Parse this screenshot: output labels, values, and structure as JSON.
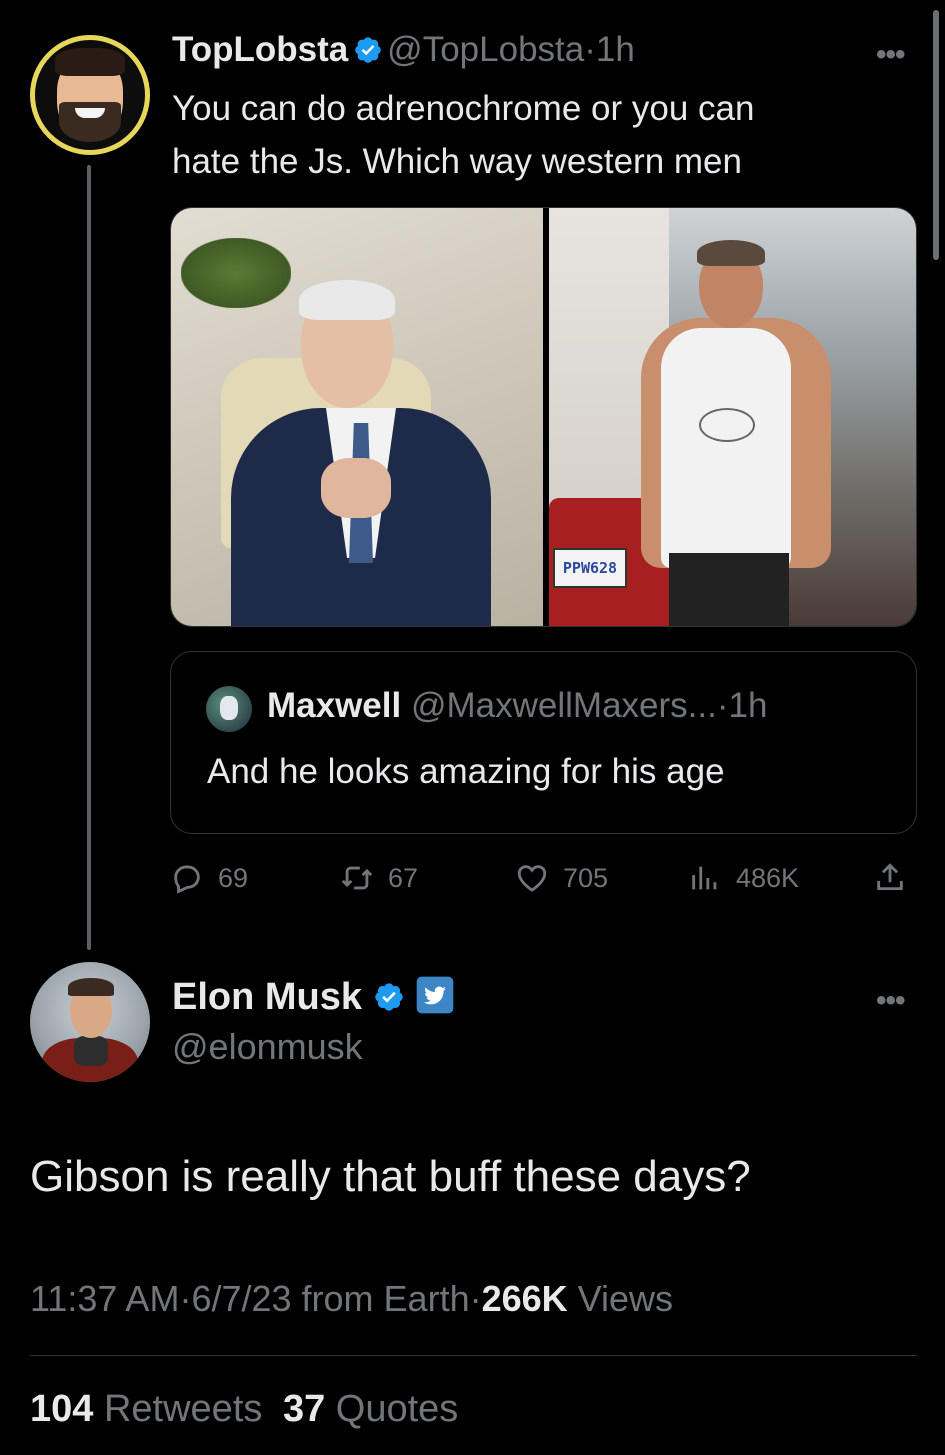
{
  "colors": {
    "background": "#000000",
    "text": "#e7e9ea",
    "muted": "#71767b",
    "verified": "#1d9bf0",
    "border": "#2f3336"
  },
  "tweet": {
    "author_name": "TopLobsta",
    "author_handle": "@TopLobsta",
    "dot": "·",
    "time": "1h",
    "text_line1": "You can do adrenochrome or you can",
    "text_line2": "hate the Js. Which way western men",
    "more_label": "•••",
    "media": {
      "plate_text": "PPW628"
    },
    "quote": {
      "author_name": "Maxwell",
      "author_handle": "@MaxwellMaxers...",
      "time": "1h",
      "text": "And he looks amazing for his age"
    },
    "actions": {
      "replies": "69",
      "retweets": "67",
      "likes": "705",
      "views": "486K"
    }
  },
  "reply": {
    "author_name": "Elon Musk",
    "author_handle": "@elonmusk",
    "more_label": "•••",
    "text": "Gibson is really that buff these days?",
    "time": "11:37 AM",
    "date": "6/7/23",
    "source": "from Earth",
    "views_count": "266K",
    "views_label": "Views",
    "retweets_count": "104",
    "retweets_label": "Retweets",
    "quotes_count": "37",
    "quotes_label": "Quotes"
  },
  "icons": [
    "verified-badge-icon",
    "twitter-bird-icon",
    "reply-icon",
    "retweet-icon",
    "like-icon",
    "views-icon",
    "share-icon",
    "more-icon"
  ]
}
